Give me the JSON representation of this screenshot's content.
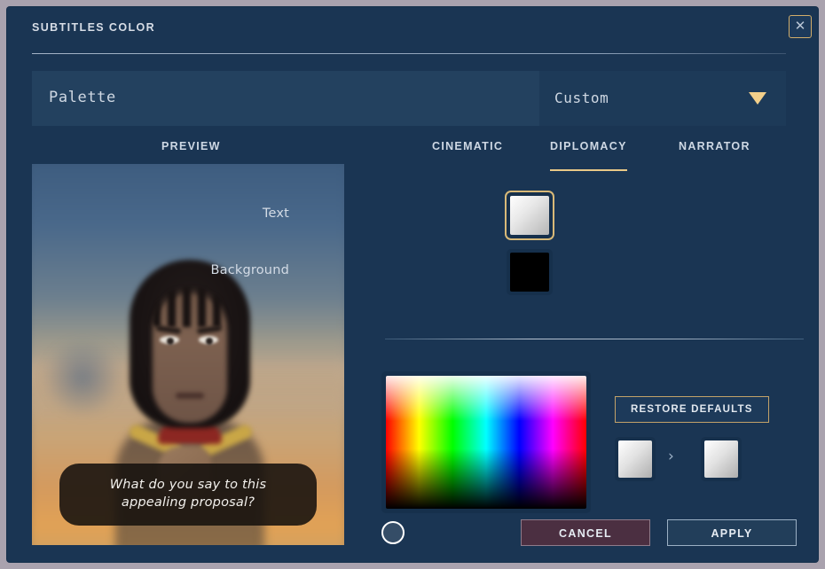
{
  "window": {
    "title": "SUBTITLES COLOR",
    "close_icon": "close-icon",
    "background_color": "#1a3553"
  },
  "selector": {
    "palette_label": "Palette",
    "custom_label": "Custom",
    "caret_icon": "chevron-down-icon",
    "caret_color": "#f2cf8a"
  },
  "tabs": [
    {
      "label": "PREVIEW",
      "active": false
    },
    {
      "label": "CINEMATIC",
      "active": false
    },
    {
      "label": "DIPLOMACY",
      "active": true
    },
    {
      "label": "NARRATOR",
      "active": false
    }
  ],
  "preview": {
    "subtitle_line1": "What do you say to this",
    "subtitle_line2": "appealing proposal?",
    "subtitle_text": "What do you say to this appealing proposal?"
  },
  "settings": {
    "text_label": "Text",
    "text_color": "#d5d5d5",
    "text_selected": true,
    "background_label": "Background",
    "background_color": "#000000",
    "background_selected": false
  },
  "picker": {
    "cursor_icon": "color-picker-cursor-icon",
    "selected_hue_position": "top-left"
  },
  "actions": {
    "restore_defaults_label": "RESTORE DEFAULTS",
    "compare_arrow": "›",
    "before_color": "#d5d5d5",
    "after_color": "#d5d5d5"
  },
  "footer": {
    "cancel_label": "CANCEL",
    "apply_label": "APPLY",
    "cancel_color": "#4b2f41",
    "apply_color": "#223e5a"
  }
}
